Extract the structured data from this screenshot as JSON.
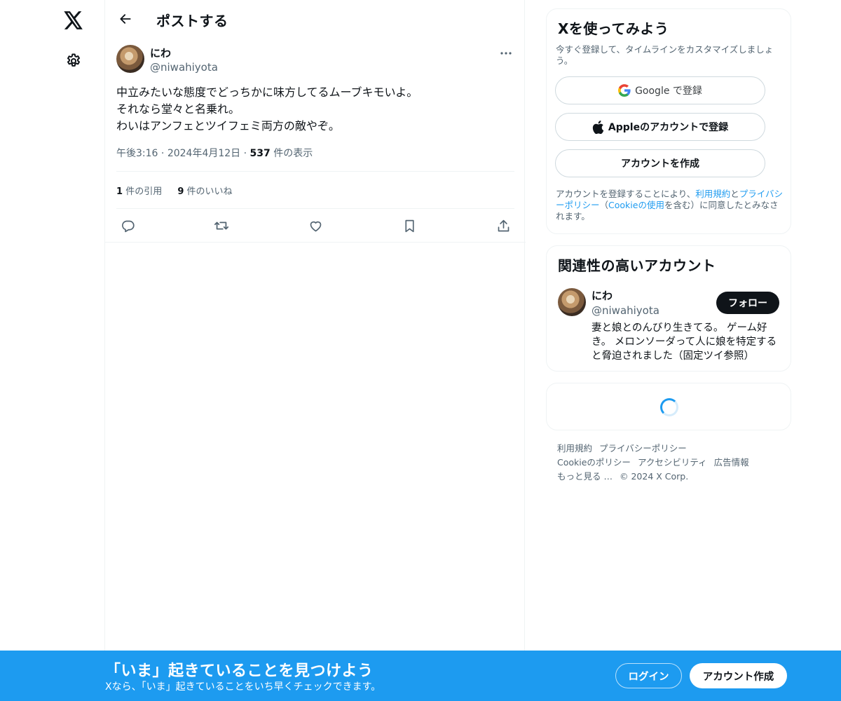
{
  "nav": {
    "logo_icon": "x-logo-icon",
    "settings_icon": "gear-icon"
  },
  "header": {
    "back_icon": "arrow-left-icon",
    "title": "ポストする"
  },
  "post": {
    "author_name": "にわ",
    "author_handle": "@niwahiyota",
    "more_icon": "more-horizontal-icon",
    "lines": [
      "中立みたいな態度でどっちかに味方してるムーブキモいよ。",
      "それなら堂々と名乗れ。",
      "わいはアンフェとツイフェミ両方の敵やぞ。"
    ],
    "time": "午後3:16",
    "date": "2024年4月12日",
    "views_count": "537",
    "views_label": "件の表示",
    "quotes_count": "1",
    "quotes_label": "件の引用",
    "likes_count": "9",
    "likes_label": "件のいいね",
    "actions": [
      "reply-icon",
      "repost-icon",
      "like-icon",
      "bookmark-icon",
      "share-icon"
    ]
  },
  "signup_card": {
    "title": "Xを使ってみよう",
    "subtitle": "今すぐ登録して、タイムラインをカスタマイズしましょう。",
    "google_label": "Google で登録",
    "apple_label": "Appleのアカウントで登録",
    "create_label": "アカウントを作成",
    "terms_prefix": "アカウントを登録することにより、",
    "terms_link": "利用規約",
    "terms_and": "と",
    "privacy_link": "プライバシーポリシー",
    "paren_open": "（",
    "cookie_link": "Cookieの使用",
    "terms_suffix": "を含む）に同意したとみなされます。"
  },
  "related": {
    "title": "関連性の高いアカウント",
    "name": "にわ",
    "handle": "@niwahiyota",
    "follow_label": "フォロー",
    "bio": "妻と娘とのんびり生きてる。 ゲーム好き。 メロンソーダって人に娘を特定すると脅迫されました（固定ツイ参照）"
  },
  "footer": {
    "links": [
      "利用規約",
      "プライバシーポリシー",
      "Cookieのポリシー",
      "アクセシビリティ",
      "広告情報",
      "もっと見る …"
    ],
    "copyright": "© 2024 X Corp."
  },
  "banner": {
    "title": "「いま」起きていることを見つけよう",
    "subtitle": "Xなら、「いま」起きていることをいち早くチェックできます。",
    "login_label": "ログイン",
    "signup_label": "アカウント作成"
  },
  "colors": {
    "accent": "#1d9bf0",
    "text_primary": "#0f1419",
    "text_secondary": "#536471",
    "border": "#eff3f4"
  }
}
